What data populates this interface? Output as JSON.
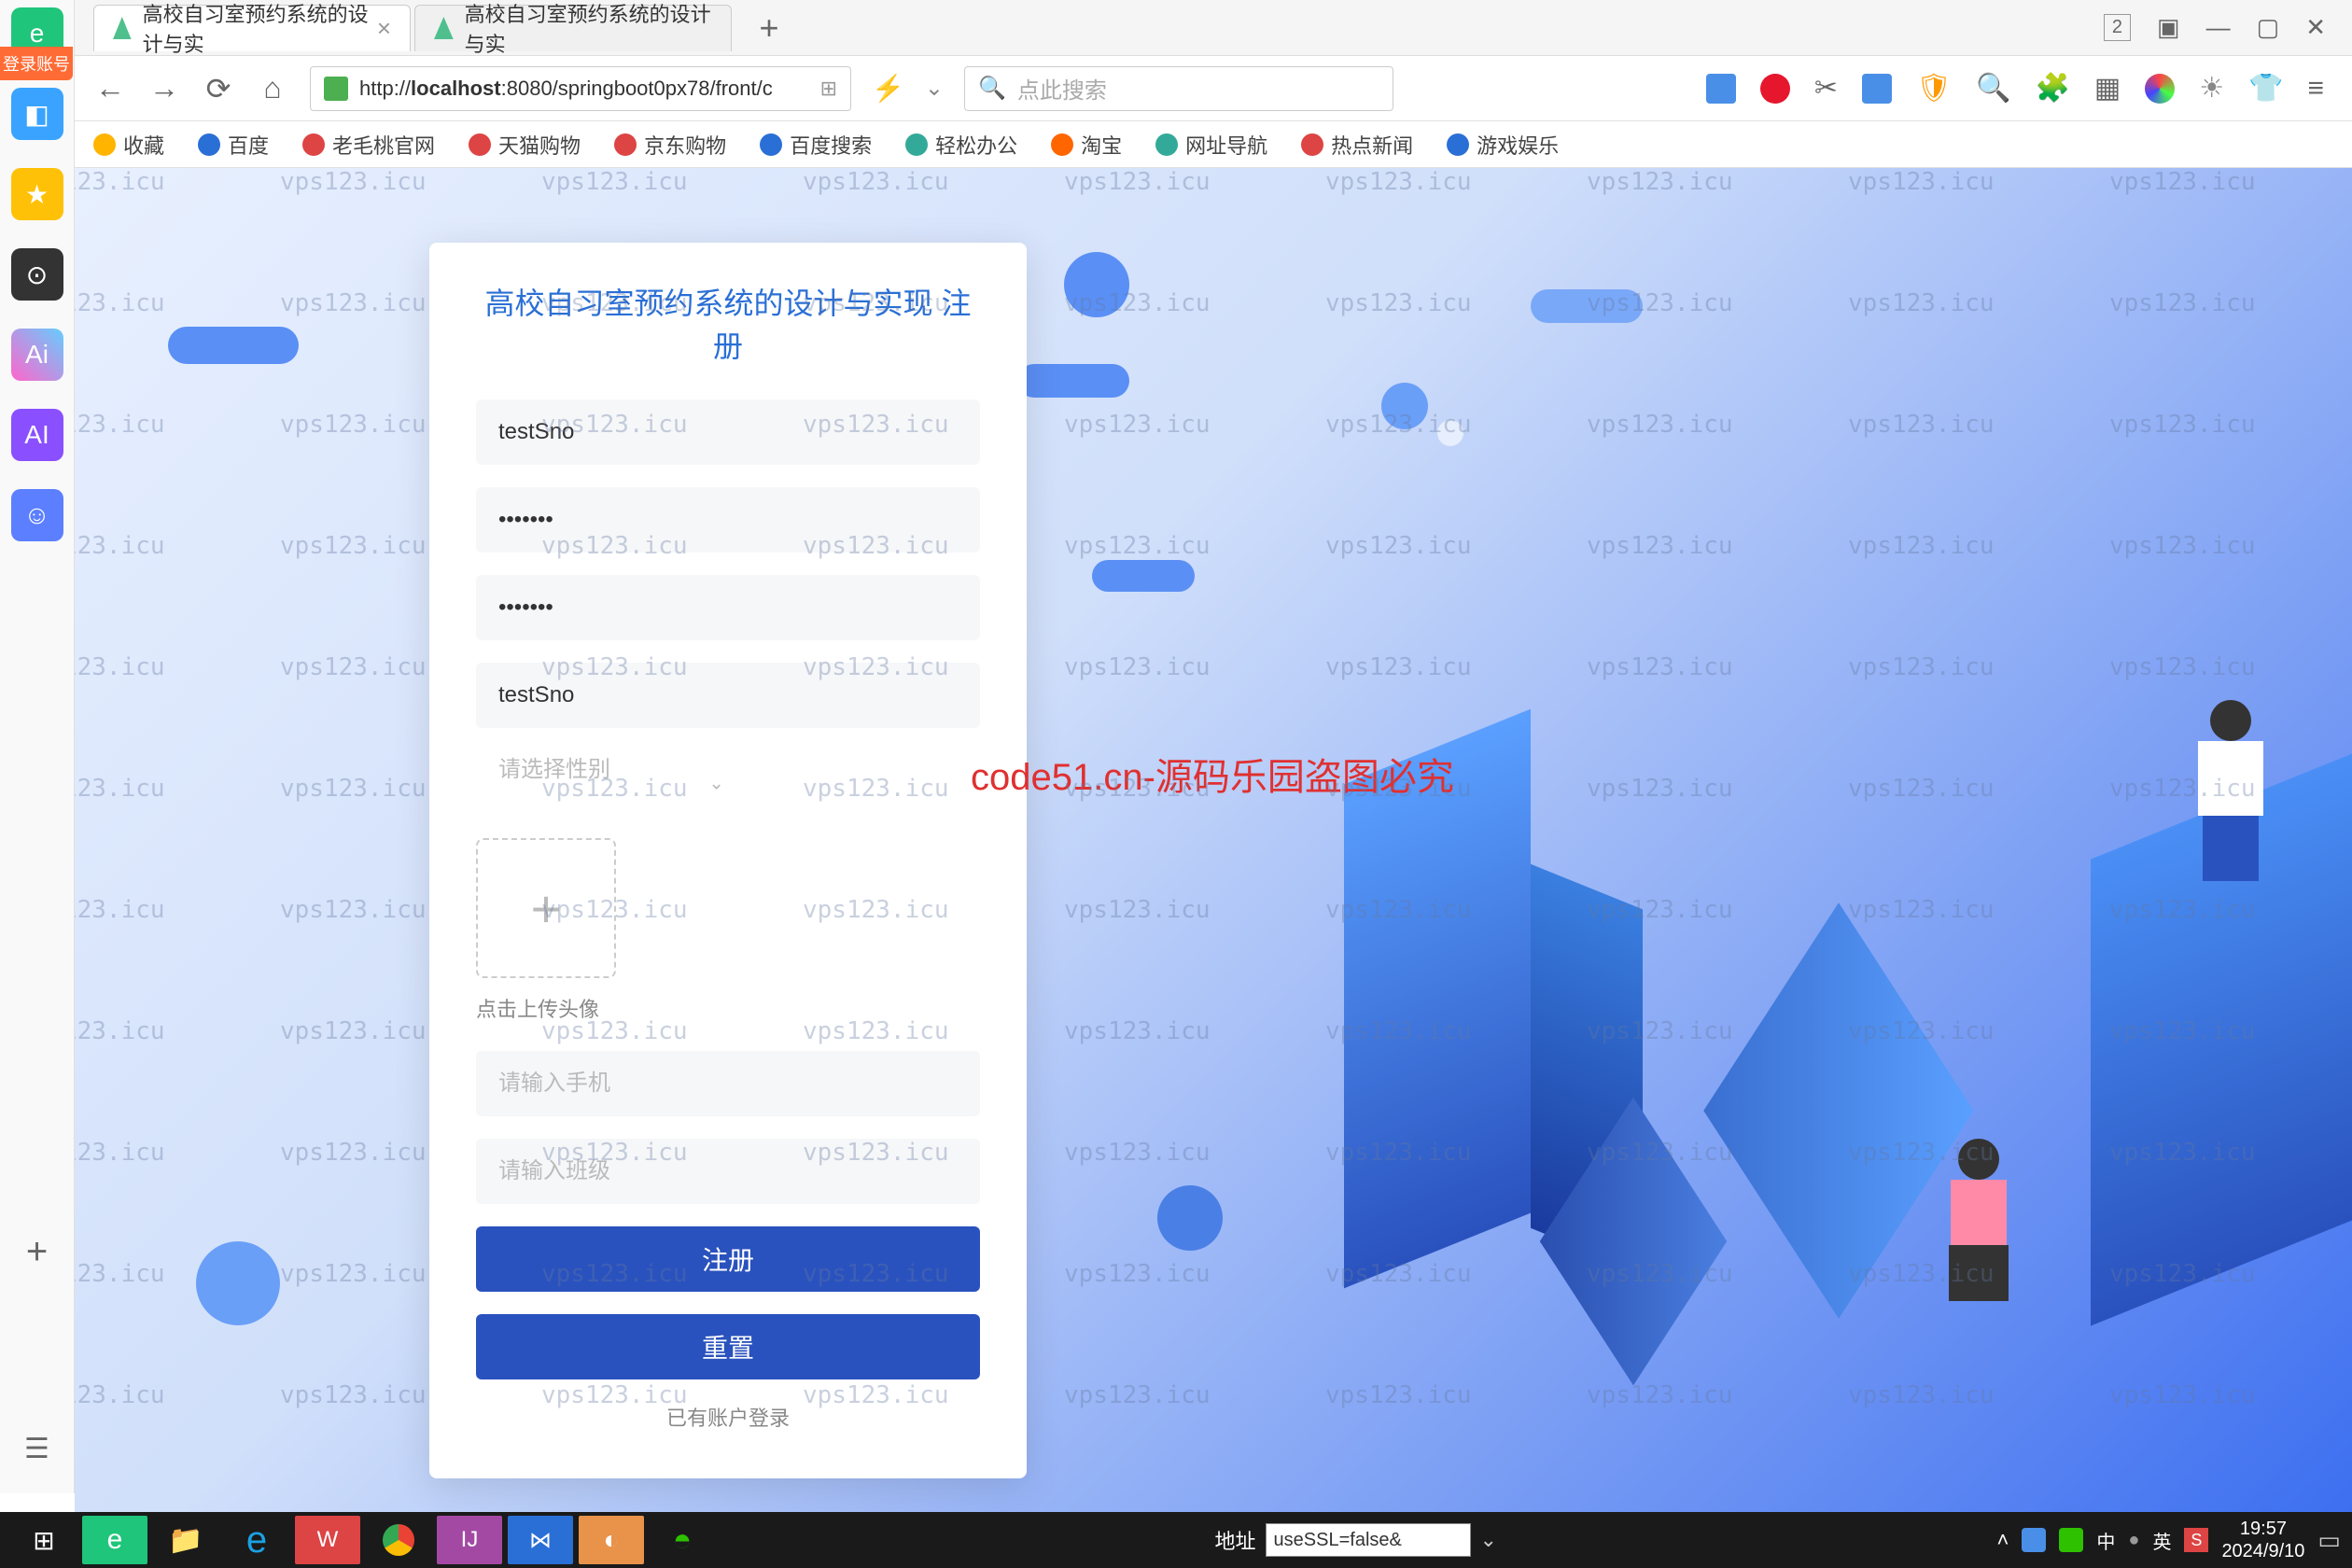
{
  "browser": {
    "tabs": [
      {
        "title": "高校自习室预约系统的设计与实"
      },
      {
        "title": "高校自习室预约系统的设计与实"
      }
    ],
    "url_prefix": "http://",
    "url_host": "localhost",
    "url_rest": ":8080/springboot0px78/front/c",
    "search_placeholder": "点此搜索",
    "login_badge": "登录账号",
    "window_count": "2"
  },
  "bookmarks": [
    {
      "label": "收藏",
      "color": "#ffb400"
    },
    {
      "label": "百度",
      "color": "#2a6fd6"
    },
    {
      "label": "老毛桃官网",
      "color": "#d44"
    },
    {
      "label": "天猫购物",
      "color": "#d44"
    },
    {
      "label": "京东购物",
      "color": "#d44"
    },
    {
      "label": "百度搜索",
      "color": "#2a6fd6"
    },
    {
      "label": "轻松办公",
      "color": "#3a9"
    },
    {
      "label": "淘宝",
      "color": "#f60"
    },
    {
      "label": "网址导航",
      "color": "#3a9"
    },
    {
      "label": "热点新闻",
      "color": "#d44"
    },
    {
      "label": "游戏娱乐",
      "color": "#2a6fd6"
    }
  ],
  "form": {
    "title": "高校自习室预约系统的设计与实现 注册",
    "sno_value": "testSno",
    "pwd_value": "•••••••",
    "pwd2_value": "•••••••",
    "name_value": "testSno",
    "gender_placeholder": "请选择性别",
    "upload_label": "点击上传头像",
    "phone_placeholder": "请输入手机",
    "class_placeholder": "请输入班级",
    "register_btn": "注册",
    "reset_btn": "重置",
    "login_link": "已有账户登录"
  },
  "overlay": {
    "watermark": "vps123.icu",
    "center_text": "code51.cn-源码乐园盗图必究"
  },
  "taskbar": {
    "addr_label": "地址",
    "addr_value": "useSSL=false&",
    "ime1": "中",
    "ime2": "英",
    "time": "19:57",
    "date": "2024/9/10"
  }
}
